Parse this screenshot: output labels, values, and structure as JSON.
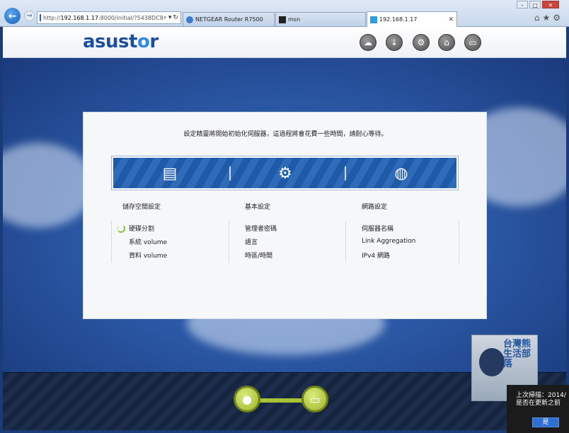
{
  "browser": {
    "url_prefix": "http://",
    "url_host": "192.168.1.17",
    "url_rest": ":8000/initial/?5438DC8",
    "tabs": [
      {
        "label": "NETGEAR Router R7500"
      },
      {
        "label": "msn"
      },
      {
        "label": "192.168.1.17",
        "close": "✕"
      }
    ],
    "window_controls": {
      "minimize": "–",
      "maximize": "□",
      "close": "✕"
    }
  },
  "app": {
    "logo_text_a": "asust",
    "logo_text_b": "o",
    "logo_text_c": "r"
  },
  "panel": {
    "intro": "設定精靈將開始初始化伺服器，這過程將會花費一些時間，請耐心等待。",
    "columns": [
      {
        "title": "儲存空間設定",
        "items": [
          "硬碟分割",
          "系統 volume",
          "資料 volume"
        ]
      },
      {
        "title": "基本設定",
        "items": [
          "管理者密碼",
          "語言",
          "時區/時間"
        ]
      },
      {
        "title": "網路設定",
        "items": [
          "伺服器名稱",
          "Link Aggregation",
          "IPv4 網路"
        ]
      }
    ]
  },
  "overlay": {
    "photo_text": "台灣熊 生活部落",
    "notify_line1": "上次掃描：2014/",
    "notify_line2": "是否在更新之前",
    "notify_button": "是"
  },
  "icons": {
    "step1": "storage-icon",
    "step2": "gear-icon",
    "step3": "globe-icon",
    "progress1": "user-icon",
    "progress2": "battery-icon"
  },
  "colors": {
    "accent": "#1e5aa8",
    "progress": "#a8c236"
  }
}
